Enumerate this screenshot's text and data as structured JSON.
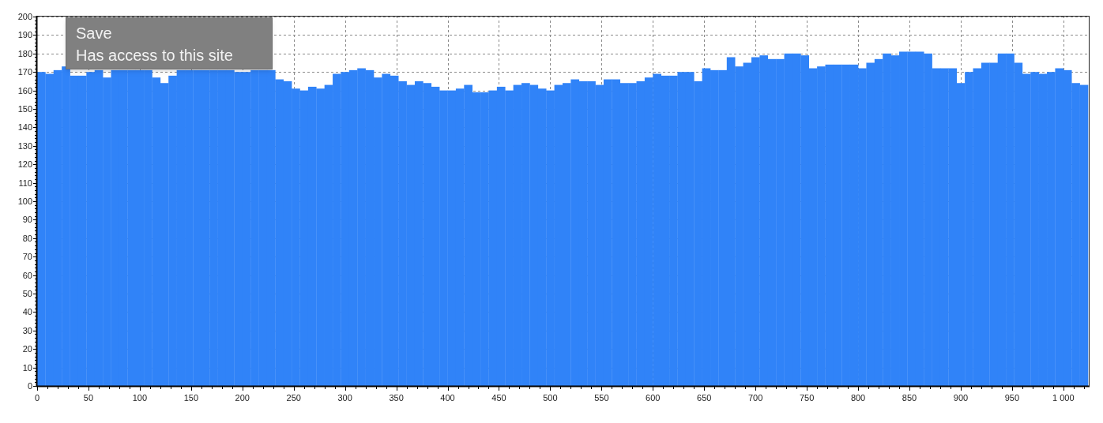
{
  "chart": {
    "chart_data": {
      "type": "bar",
      "color": "#3083f8",
      "x": [
        0,
        8,
        16,
        24,
        32,
        40,
        48,
        56,
        64,
        72,
        80,
        88,
        96,
        104,
        112,
        120,
        128,
        136,
        144,
        152,
        160,
        168,
        176,
        184,
        192,
        200,
        208,
        216,
        224,
        232,
        240,
        248,
        256,
        264,
        272,
        280,
        288,
        296,
        304,
        312,
        320,
        328,
        336,
        344,
        352,
        360,
        368,
        376,
        384,
        392,
        400,
        408,
        416,
        424,
        432,
        440,
        448,
        456,
        464,
        472,
        480,
        488,
        496,
        504,
        512,
        520,
        528,
        536,
        544,
        552,
        560,
        568,
        576,
        584,
        592,
        600,
        608,
        616,
        624,
        632,
        640,
        648,
        656,
        664,
        672,
        680,
        688,
        696,
        704,
        712,
        720,
        728,
        736,
        744,
        752,
        760,
        768,
        776,
        784,
        792,
        800,
        808,
        816,
        824,
        832,
        840,
        848,
        856,
        864,
        872,
        880,
        888,
        896,
        904,
        912,
        920,
        928,
        936,
        944,
        952,
        960,
        968,
        976,
        984,
        992,
        1000,
        1008,
        1016
      ],
      "values": [
        170,
        169,
        171,
        173,
        168,
        168,
        170,
        171,
        167,
        171,
        171,
        171,
        171,
        171,
        167,
        164,
        168,
        171,
        171,
        171,
        171,
        171,
        171,
        171,
        170,
        170,
        171,
        171,
        171,
        166,
        165,
        161,
        160,
        162,
        161,
        163,
        169,
        170,
        171,
        172,
        171,
        167,
        169,
        168,
        165,
        163,
        165,
        164,
        162,
        160,
        160,
        161,
        163,
        159,
        159,
        160,
        162,
        160,
        163,
        164,
        163,
        161,
        160,
        163,
        164,
        166,
        165,
        165,
        163,
        166,
        166,
        164,
        164,
        165,
        167,
        169,
        168,
        168,
        170,
        170,
        165,
        172,
        171,
        171,
        178,
        173,
        175,
        178,
        179,
        177,
        177,
        180,
        180,
        179,
        172,
        173,
        174,
        174,
        174,
        174,
        172,
        175,
        177,
        180,
        179,
        181,
        181,
        181,
        180,
        172,
        172,
        172,
        164,
        170,
        172,
        175,
        175,
        180,
        180,
        175,
        169,
        170,
        169,
        170,
        172,
        171,
        164,
        163
      ],
      "xlim": [
        0,
        1024
      ],
      "ylim": [
        0,
        200
      ],
      "grid": true,
      "xticks": [
        0,
        50,
        100,
        150,
        200,
        250,
        300,
        350,
        400,
        450,
        500,
        550,
        600,
        650,
        700,
        750,
        800,
        850,
        900,
        950,
        {
          "value": 1000,
          "label": "1 000"
        }
      ],
      "yticks": [
        0,
        10,
        20,
        30,
        40,
        50,
        60,
        70,
        80,
        90,
        100,
        110,
        120,
        130,
        140,
        150,
        160,
        170,
        180,
        190,
        200
      ]
    }
  },
  "tooltip": {
    "title": "Save",
    "subtitle": "Has access to this site"
  }
}
